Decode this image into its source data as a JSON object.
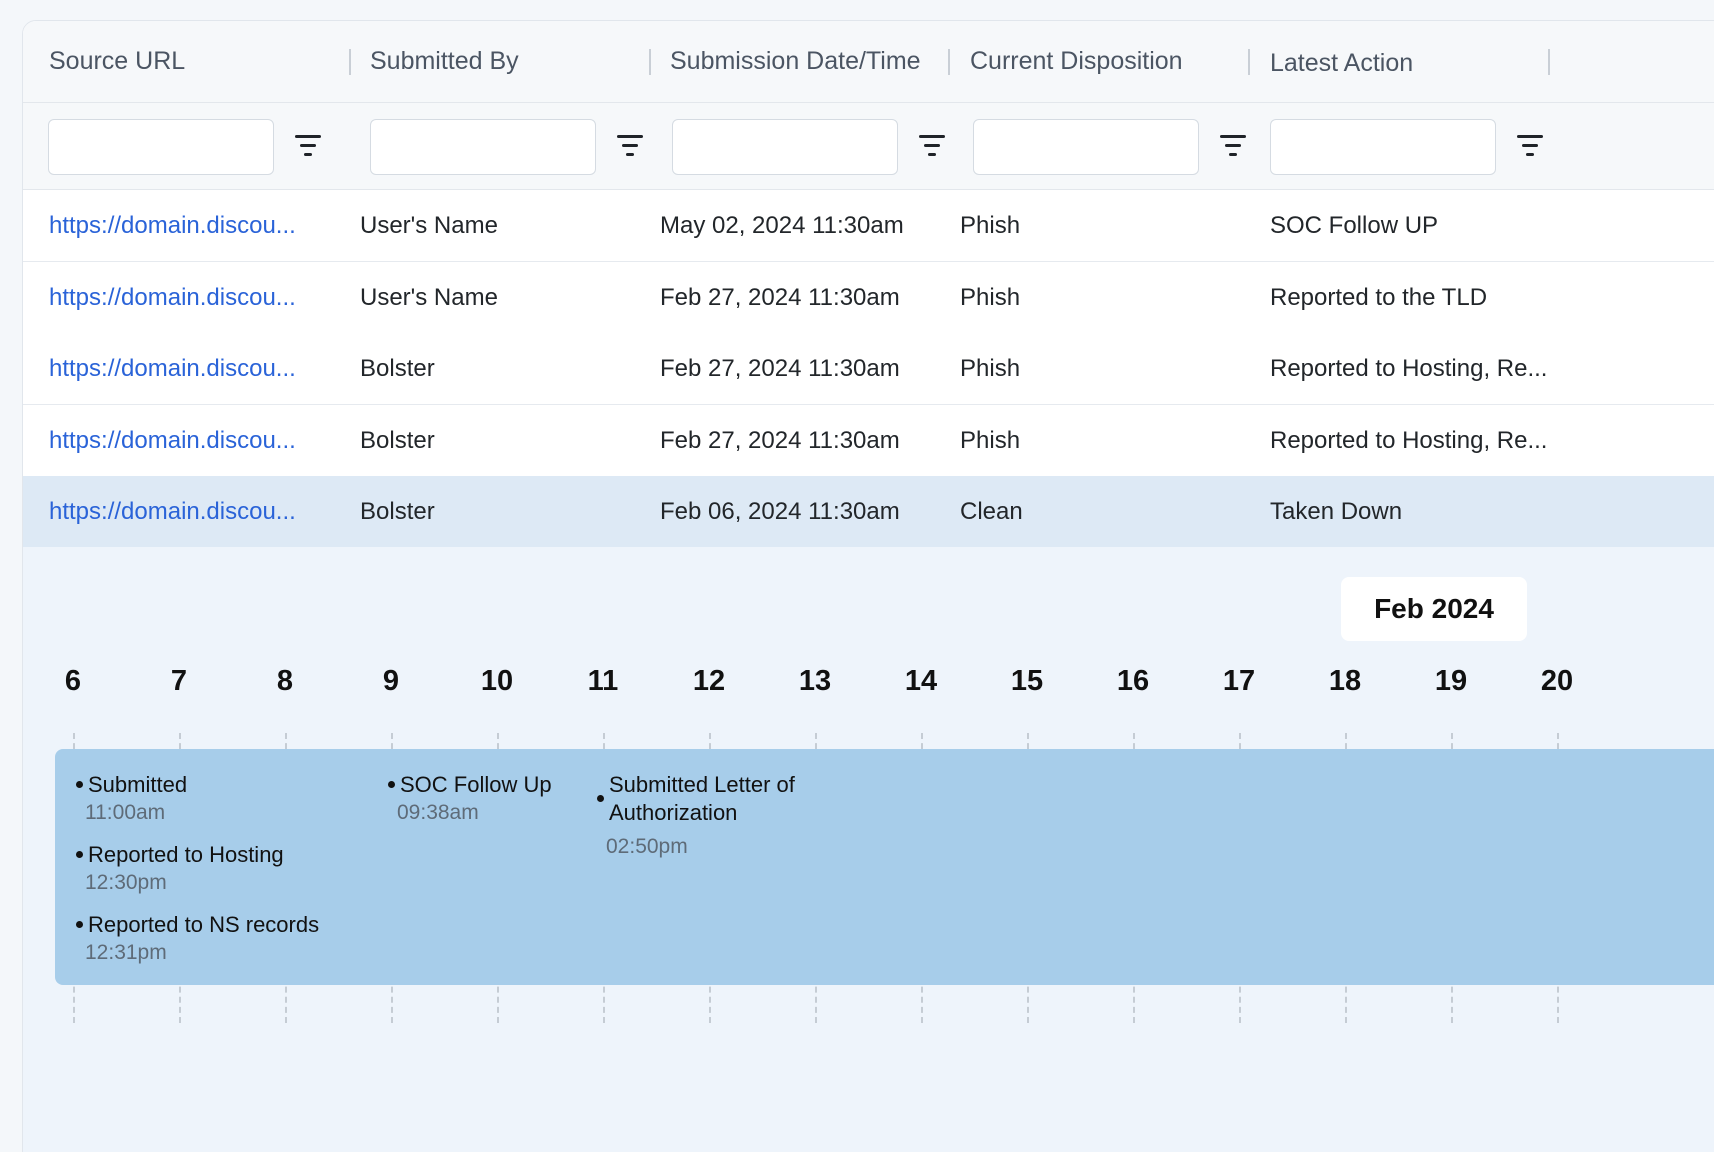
{
  "table": {
    "columns": [
      "Source URL",
      "Submitted By",
      "Submission Date/Time",
      "Current Disposition",
      "Latest Action"
    ],
    "rows": [
      {
        "url": "https://domain.discou...",
        "submitted_by": "User's Name",
        "date": "May 02, 2024  11:30am",
        "disposition": "Phish",
        "action": "SOC Follow UP"
      },
      {
        "url": "https://domain.discou...",
        "submitted_by": "User's Name",
        "date": "Feb 27, 2024  11:30am",
        "disposition": "Phish",
        "action": "Reported to the TLD"
      },
      {
        "url": "https://domain.discou...",
        "submitted_by": "Bolster",
        "date": "Feb 27, 2024  11:30am",
        "disposition": "Phish",
        "action": "Reported to Hosting, Re..."
      },
      {
        "url": "https://domain.discou...",
        "submitted_by": "Bolster",
        "date": "Feb 27, 2024  11:30am",
        "disposition": "Phish",
        "action": "Reported to Hosting, Re..."
      },
      {
        "url": "https://domain.discou...",
        "submitted_by": "Bolster",
        "date": "Feb 06, 2024  11:30am",
        "disposition": "Clean",
        "action": "Taken Down"
      }
    ],
    "selected_row": 5
  },
  "timeline": {
    "month": "Feb 2024",
    "days": [
      "6",
      "7",
      "8",
      "9",
      "10",
      "11",
      "12",
      "13",
      "14",
      "15",
      "16",
      "17",
      "18",
      "19",
      "20"
    ],
    "events": [
      {
        "title": "Submitted",
        "time": "11:00am"
      },
      {
        "title": "Reported to Hosting",
        "time": "12:30pm"
      },
      {
        "title": "Reported to NS records",
        "time": "12:31pm"
      },
      {
        "title": "SOC Follow Up",
        "time": "09:38am"
      },
      {
        "title": "Submitted Letter of",
        "title2": "Authorization",
        "time": "02:50pm"
      }
    ]
  },
  "icons": {
    "filter": "filter-icon"
  },
  "colors": {
    "link": "#2a63d8",
    "selected_row": "#dde9f5",
    "timeline_bg": "#eef4fb",
    "event_bar": "#a7cdea"
  }
}
